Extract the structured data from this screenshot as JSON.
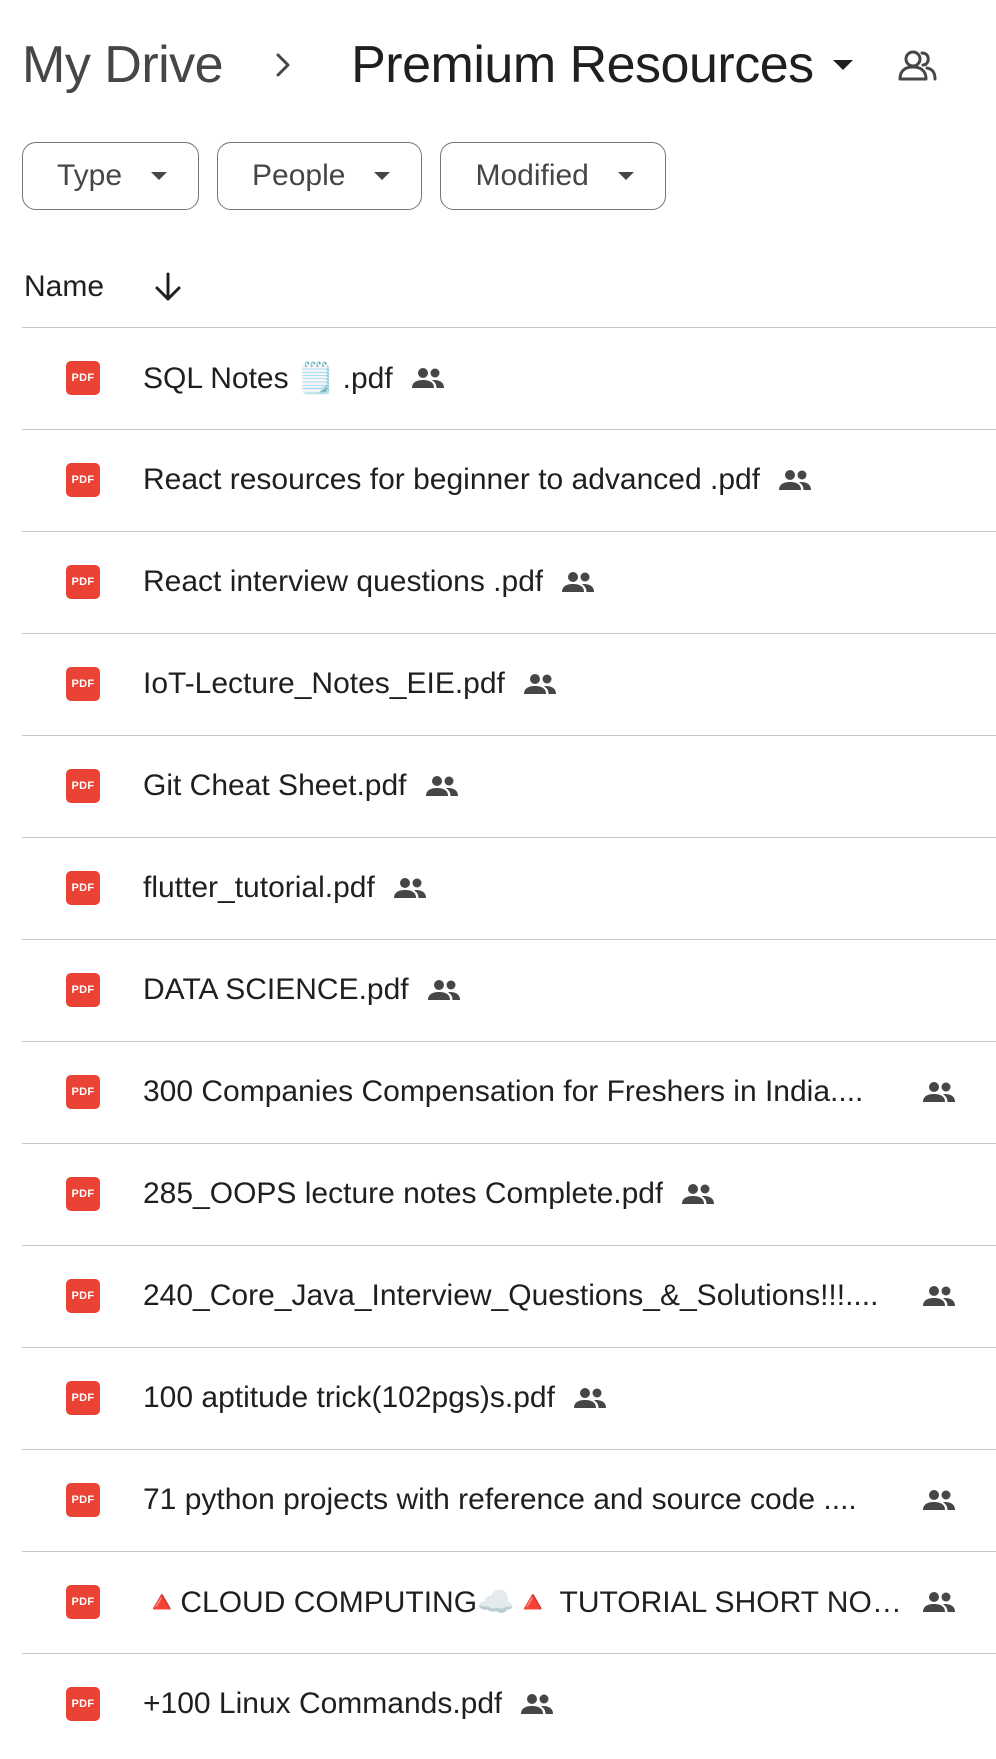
{
  "breadcrumb": {
    "root": "My Drive",
    "current": "Premium Resources"
  },
  "filters": [
    {
      "label": "Type"
    },
    {
      "label": "People"
    },
    {
      "label": "Modified"
    }
  ],
  "sort": {
    "label": "Name",
    "direction": "descending"
  },
  "colors": {
    "pdf_icon": "#ea4335",
    "divider": "#c4c7c5",
    "text": "#1f1f1f",
    "muted": "#444746"
  },
  "icons": {
    "file": "pdf-icon",
    "shared": "people-icon",
    "folder_shared": "shared-folder-icon"
  },
  "files": [
    {
      "name": "SQL Notes 🗒️ .pdf",
      "shared": true,
      "truncated": false
    },
    {
      "name": "React resources for beginner to advanced .pdf",
      "shared": true,
      "truncated": false
    },
    {
      "name": "React interview questions .pdf",
      "shared": true,
      "truncated": false
    },
    {
      "name": "IoT-Lecture_Notes_EIE.pdf",
      "shared": true,
      "truncated": false
    },
    {
      "name": "Git Cheat Sheet.pdf",
      "shared": true,
      "truncated": false
    },
    {
      "name": "flutter_tutorial.pdf",
      "shared": true,
      "truncated": false
    },
    {
      "name": "DATA SCIENCE.pdf",
      "shared": true,
      "truncated": false
    },
    {
      "name": "300 Companies Compensation for Freshers in India....",
      "shared": true,
      "truncated": true
    },
    {
      "name": "285_OOPS lecture notes Complete.pdf",
      "shared": true,
      "truncated": false
    },
    {
      "name": "240_Core_Java_Interview_Questions_&_Solutions!!!....",
      "shared": true,
      "truncated": true
    },
    {
      "name": "100 aptitude trick(102pgs)s.pdf",
      "shared": true,
      "truncated": false
    },
    {
      "name": "71 python projects with reference and source code ....",
      "shared": true,
      "truncated": true
    },
    {
      "name": "🔺CLOUD COMPUTING☁️🔺 TUTORIAL SHORT NOT...",
      "shared": true,
      "truncated": true
    },
    {
      "name": "+100 Linux Commands.pdf",
      "shared": true,
      "truncated": false
    }
  ]
}
